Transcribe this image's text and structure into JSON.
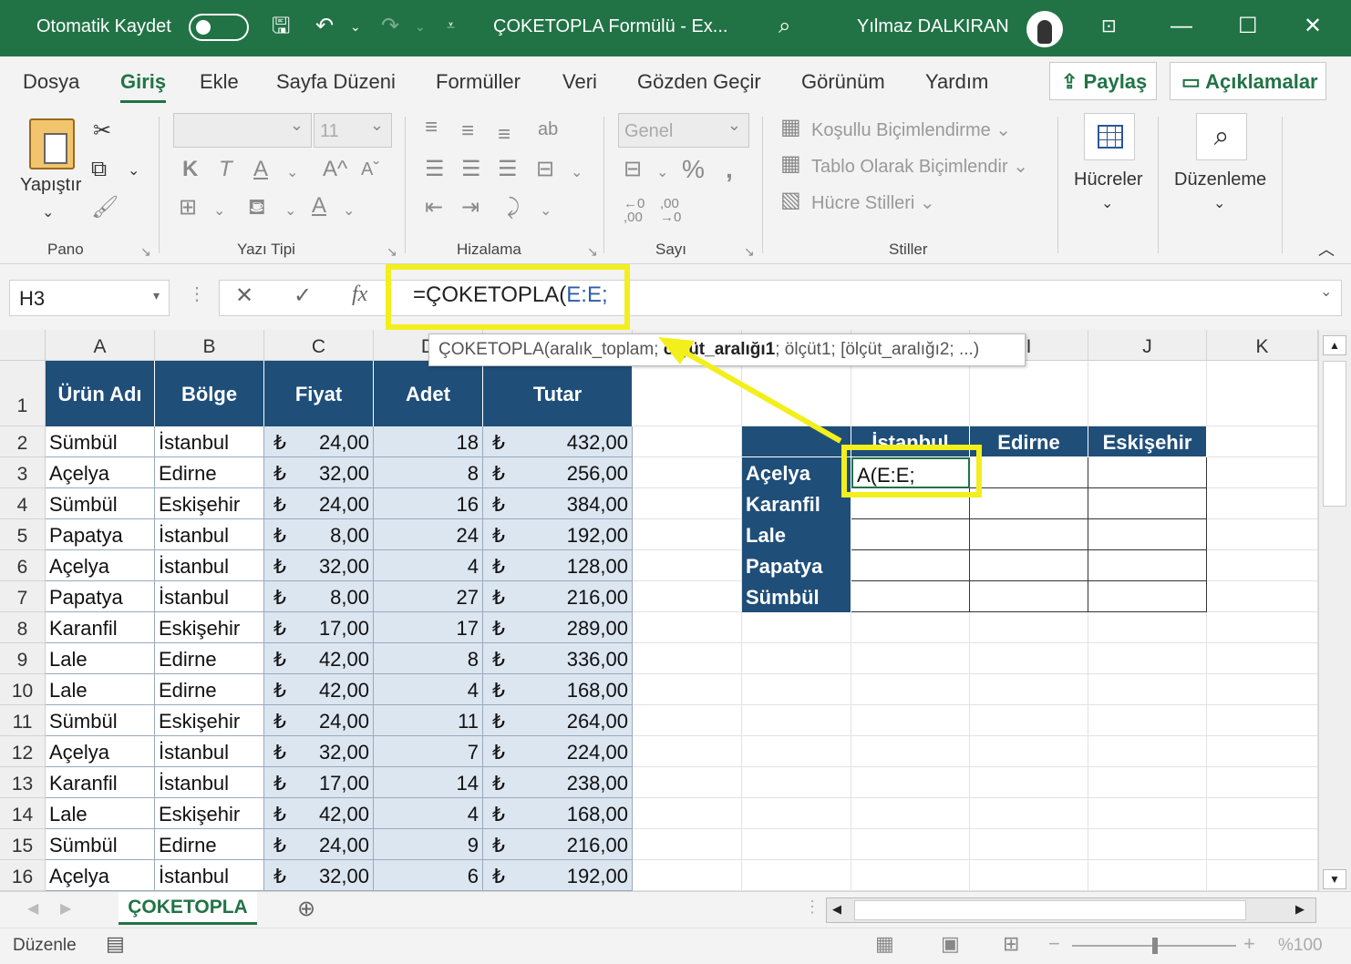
{
  "titlebar": {
    "autosave_label": "Otomatik Kaydet",
    "doc_title": "ÇOKETOPLA Formülü  -  Ex...",
    "user_name": "Yılmaz DALKIRAN"
  },
  "menu": {
    "items": [
      "Dosya",
      "Giriş",
      "Ekle",
      "Sayfa Düzeni",
      "Formüller",
      "Veri",
      "Gözden Geçir",
      "Görünüm",
      "Yardım"
    ],
    "share": "Paylaş",
    "comments": "Açıklamalar"
  },
  "ribbon": {
    "paste": "Yapıştır",
    "font_size": "11",
    "number_format": "Genel",
    "conditional": "Koşullu Biçimlendirme",
    "format_table": "Tablo Olarak Biçimlendir",
    "cell_styles": "Hücre Stilleri",
    "cells": "Hücreler",
    "editing": "Düzenleme",
    "groups": [
      "Pano",
      "Yazı Tipi",
      "Hizalama",
      "Sayı",
      "Stiller"
    ]
  },
  "formula_bar": {
    "name_box": "H3",
    "formula_prefix": "=ÇOKETOPLA(",
    "formula_ref": "E:E;"
  },
  "tooltip": {
    "sig_start": "ÇOKETOPLA(aralık_toplam; ",
    "sig_bold": "ölçüt_aralığı1",
    "sig_end": "; ölçüt1; [ölçüt_aralığı2; ...)"
  },
  "columns": [
    "A",
    "B",
    "C",
    "D",
    "",
    "",
    "",
    "",
    "I",
    "J",
    "K"
  ],
  "rows": [
    "1",
    "2",
    "3",
    "4",
    "5",
    "6",
    "7",
    "8",
    "9",
    "10",
    "11",
    "12",
    "13",
    "14",
    "15",
    "16"
  ],
  "table": {
    "headers": [
      "Ürün Adı",
      "Bölge",
      "Fiyat",
      "Adet",
      "Tutar"
    ],
    "currency": "₺",
    "rows": [
      [
        "Sümbül",
        "İstanbul",
        "24,00",
        "18",
        "432,00"
      ],
      [
        "Açelya",
        "Edirne",
        "32,00",
        "8",
        "256,00"
      ],
      [
        "Sümbül",
        "Eskişehir",
        "24,00",
        "16",
        "384,00"
      ],
      [
        "Papatya",
        "İstanbul",
        "8,00",
        "24",
        "192,00"
      ],
      [
        "Açelya",
        "İstanbul",
        "32,00",
        "4",
        "128,00"
      ],
      [
        "Papatya",
        "İstanbul",
        "8,00",
        "27",
        "216,00"
      ],
      [
        "Karanfil",
        "Eskişehir",
        "17,00",
        "17",
        "289,00"
      ],
      [
        "Lale",
        "Edirne",
        "42,00",
        "8",
        "336,00"
      ],
      [
        "Lale",
        "Edirne",
        "42,00",
        "4",
        "168,00"
      ],
      [
        "Sümbül",
        "Eskişehir",
        "24,00",
        "11",
        "264,00"
      ],
      [
        "Açelya",
        "İstanbul",
        "32,00",
        "7",
        "224,00"
      ],
      [
        "Karanfil",
        "İstanbul",
        "17,00",
        "14",
        "238,00"
      ],
      [
        "Lale",
        "Eskişehir",
        "42,00",
        "4",
        "168,00"
      ],
      [
        "Sümbül",
        "Edirne",
        "24,00",
        "9",
        "216,00"
      ],
      [
        "Açelya",
        "İstanbul",
        "32,00",
        "6",
        "192,00"
      ]
    ]
  },
  "summary": {
    "columns": [
      "İstanbul",
      "Edirne",
      "Eskişehir"
    ],
    "rows": [
      "Açelya",
      "Karanfil",
      "Lale",
      "Papatya",
      "Sümbül"
    ],
    "editing_cell_text": "A(E:E;"
  },
  "sheet_tab": "ÇOKETOPLA",
  "status": {
    "mode": "Düzenle",
    "zoom": "%100"
  },
  "colors": {
    "excel_green": "#217346",
    "header_blue": "#1f4e79",
    "data_fill": "#dce6f1",
    "highlight_yellow": "#f2ef1c"
  }
}
